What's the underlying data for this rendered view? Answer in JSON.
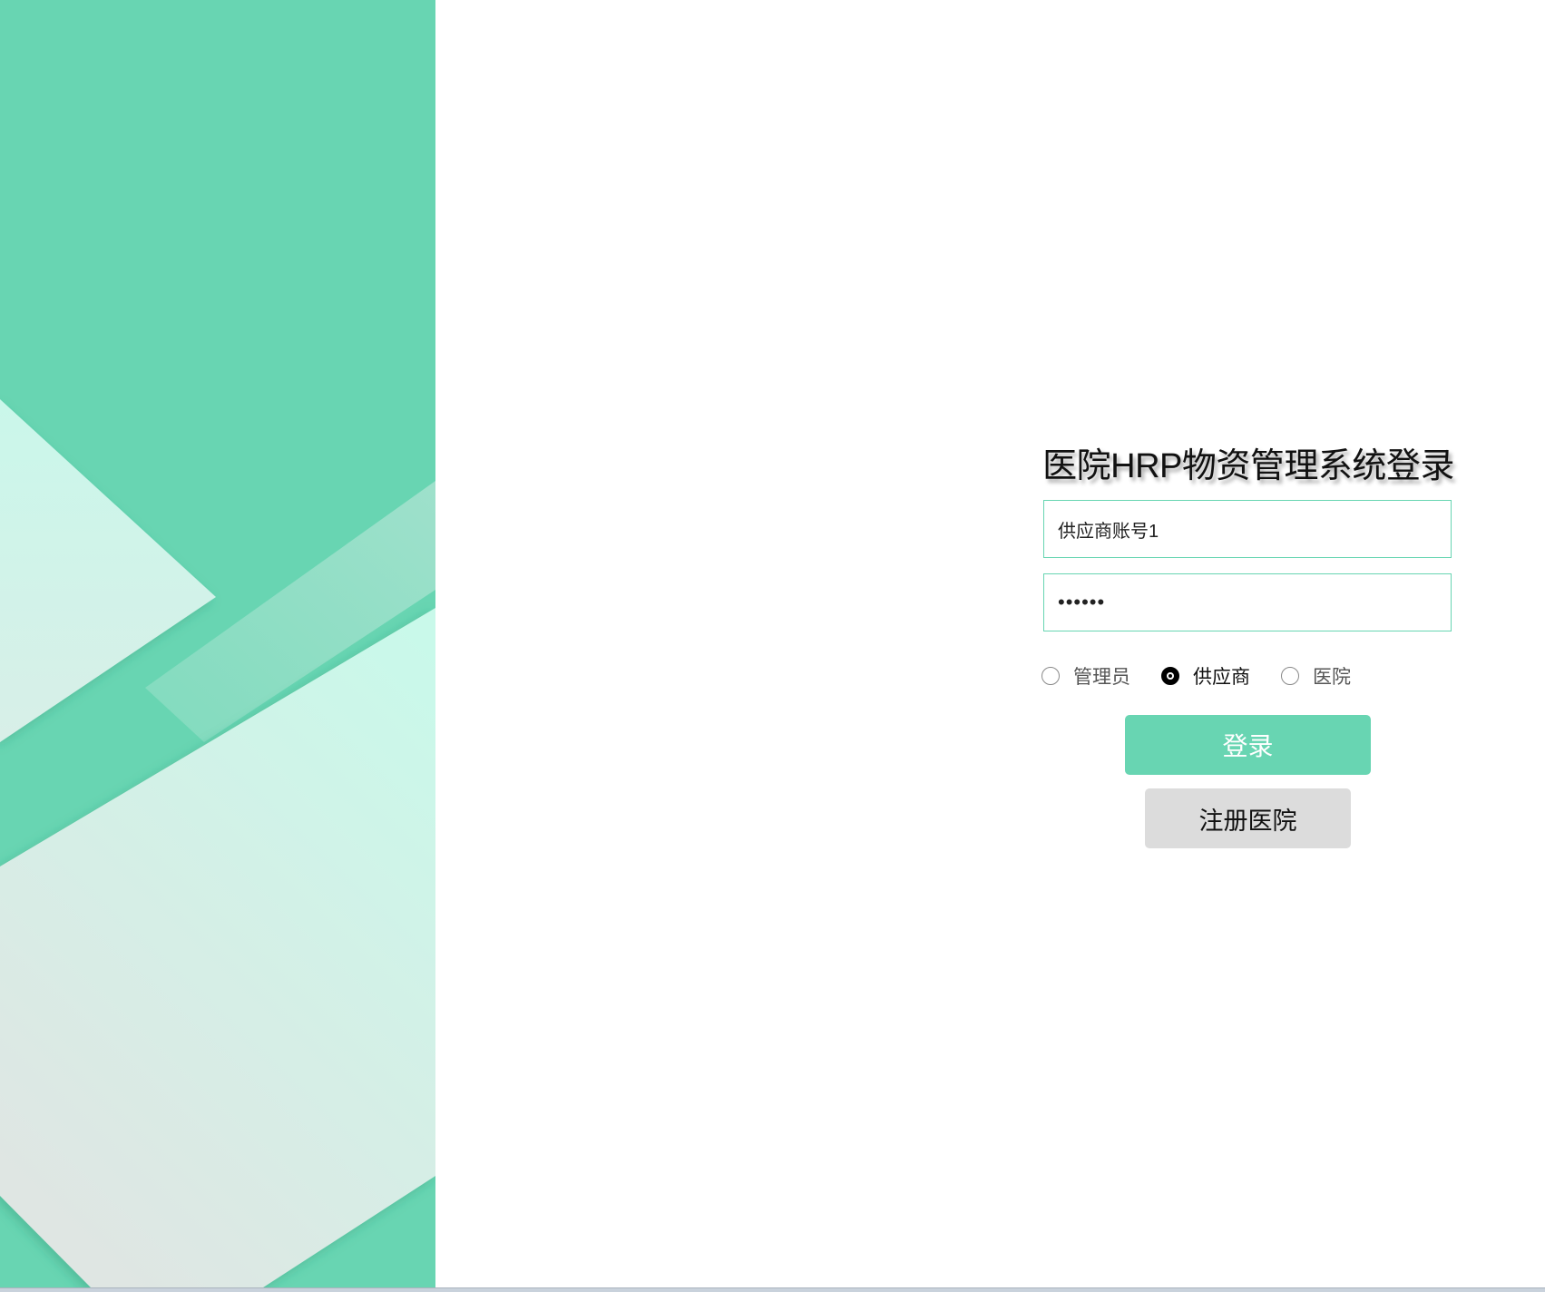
{
  "title": "医院HRP物资管理系统登录",
  "account": {
    "value": "供应商账号1"
  },
  "password": {
    "value": "••••••"
  },
  "roles": [
    {
      "label": "管理员",
      "checked": false
    },
    {
      "label": "供应商",
      "checked": true
    },
    {
      "label": "医院",
      "checked": false
    }
  ],
  "buttons": {
    "login": "登录",
    "register": "注册医院"
  },
  "colors": {
    "accent": "#68d5b2",
    "register_bg": "#dcdcdc"
  }
}
